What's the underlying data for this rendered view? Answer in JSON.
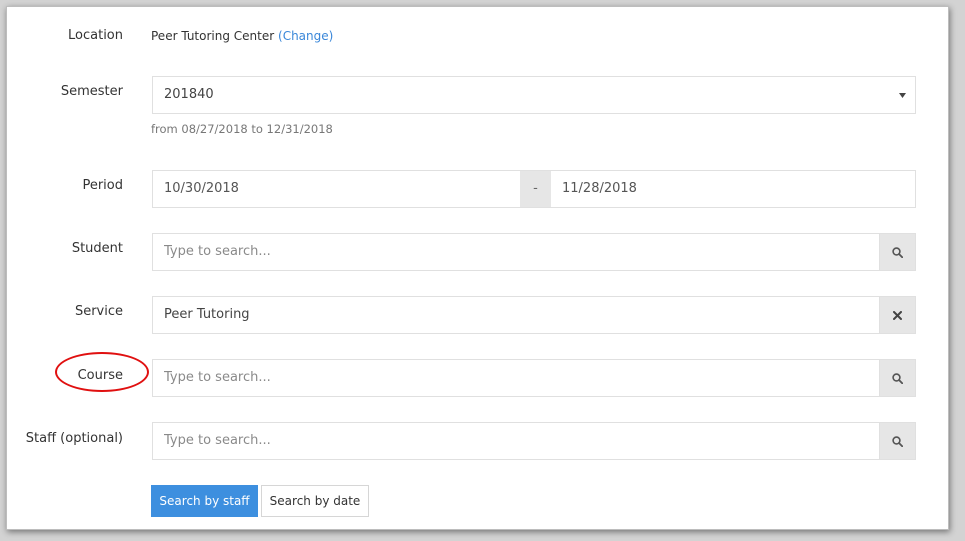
{
  "location": {
    "label": "Location",
    "value": "Peer Tutoring Center",
    "change_link": "(Change)"
  },
  "semester": {
    "label": "Semester",
    "selected": "201840",
    "hint": "from 08/27/2018 to 12/31/2018"
  },
  "period": {
    "label": "Period",
    "start": "10/30/2018",
    "separator": "-",
    "end": "11/28/2018"
  },
  "student": {
    "label": "Student",
    "placeholder": "Type to search..."
  },
  "service": {
    "label": "Service",
    "value": "Peer Tutoring"
  },
  "course": {
    "label": "Course",
    "placeholder": "Type to search..."
  },
  "staff": {
    "label": "Staff (optional)",
    "placeholder": "Type to search..."
  },
  "buttons": {
    "search_by_staff": "Search by staff",
    "search_by_date": "Search by date"
  },
  "colors": {
    "primary": "#3d8fdf",
    "link": "#3a87d9",
    "highlight": "#e01010",
    "addon_bg": "#e6e6e6"
  },
  "icons": {
    "search": "search-icon",
    "clear": "close-icon",
    "dropdown": "caret-down-icon"
  }
}
